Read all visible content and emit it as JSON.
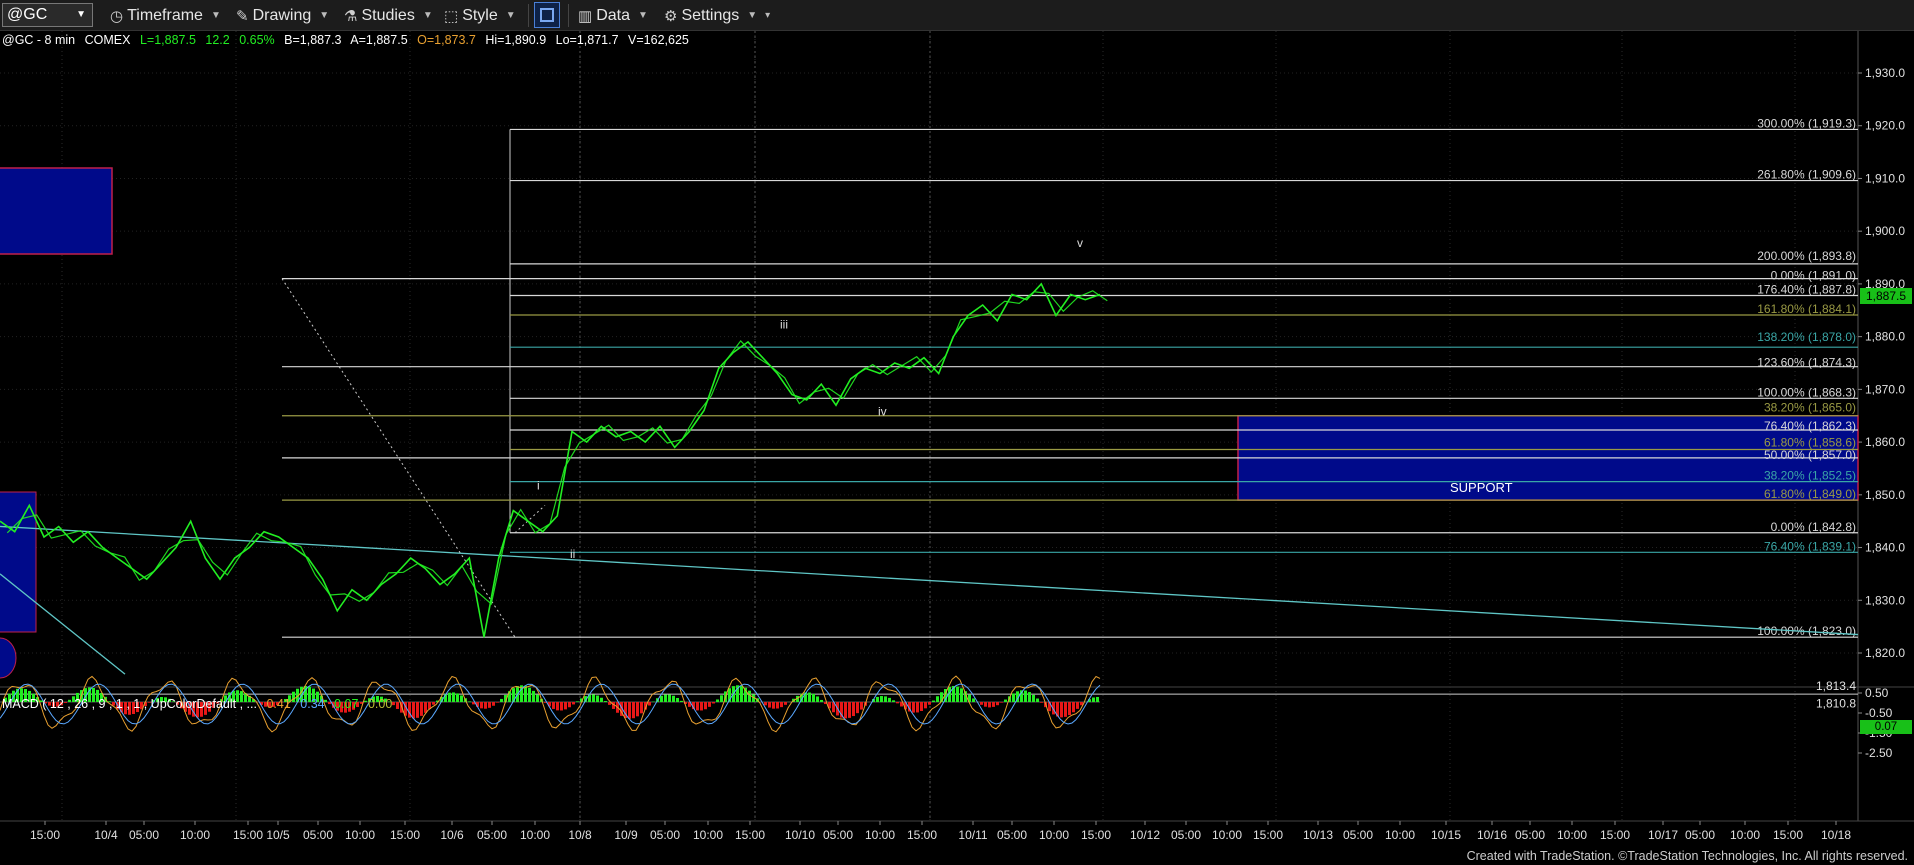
{
  "toolbar": {
    "symbol": "@GC",
    "timeframe": "Timeframe",
    "drawing": "Drawing",
    "studies": "Studies",
    "style": "Style",
    "data": "Data",
    "settings": "Settings"
  },
  "legend": {
    "symbol": "@GC - 8 min",
    "exchange": "COMEX",
    "last": "L=1,887.5",
    "change": "12.2",
    "pct": "0.65%",
    "bid": "B=1,887.3",
    "ask": "A=1,887.5",
    "open": "O=1,873.7",
    "high": "Hi=1,890.9",
    "low": "Lo=1,871.7",
    "volume": "V=162,625"
  },
  "macd_legend": {
    "label": "MACD ( 12 , 26 , 9 , 1 , 1 , UpColorDefault , ...",
    "v1": "0.41",
    "v2": "0.34",
    "v3": "0.07",
    "v4": "0.00"
  },
  "price_tag": "1,887.5",
  "macd_tag": "0.07",
  "footer": "Created with TradeStation. ©TradeStation Technologies, Inc. All rights reserved.",
  "colors": {
    "price": "#22ee22",
    "fib_white": "#d8d8d8",
    "fib_olive": "#9a9a44",
    "fib_teal": "#3aa6a6",
    "support_box": "#000a8a",
    "support_border": "#c0204a",
    "trendline": "#5fc6c6",
    "hist_pos": "#22ee22",
    "hist_neg": "#e81818"
  },
  "chart_data": {
    "type": "line",
    "title": "",
    "price_axis": {
      "min": 1810,
      "max": 1935,
      "ticks": [
        1820,
        1830,
        1840,
        1850,
        1860,
        1870,
        1880,
        1890,
        1900,
        1910,
        1920,
        1930
      ],
      "tick_labels": [
        "1,820.0",
        "1,830.0",
        "1,840.0",
        "1,850.0",
        "1,860.0",
        "1,870.0",
        "1,880.0",
        "1,890.0",
        "1,900.0",
        "1,910.0",
        "1,920.0",
        "1,930.0"
      ]
    },
    "macd_axis": {
      "ticks": [
        0.5,
        -0.5,
        -1.5,
        -2.5
      ],
      "tick_labels": [
        "0.50",
        "-0.50",
        "-1.50",
        "-2.50"
      ]
    },
    "time_labels": [
      "15:00",
      "10/4",
      "05:00",
      "10:00",
      "15:00",
      "10/5",
      "05:00",
      "10:00",
      "15:00",
      "10/6",
      "05:00",
      "10:00",
      "10/8",
      "10/9",
      "05:00",
      "10:00",
      "15:00",
      "10/10",
      "05:00",
      "10:00",
      "15:00",
      "10/11",
      "05:00",
      "10:00",
      "15:00",
      "10/12",
      "05:00",
      "10:00",
      "15:00",
      "10/13",
      "05:00",
      "10:00",
      "10/15",
      "10/16",
      "05:00",
      "10:00",
      "15:00",
      "10/17",
      "05:00",
      "10:00",
      "15:00",
      "10/18"
    ],
    "series": [
      {
        "values": [
          [
            0,
            1845
          ],
          [
            1,
            1843
          ],
          [
            2,
            1848
          ],
          [
            3,
            1842
          ],
          [
            4,
            1844
          ],
          [
            5,
            1841
          ],
          [
            6,
            1843
          ],
          [
            7,
            1840
          ],
          [
            8,
            1838
          ],
          [
            9,
            1836
          ],
          [
            10,
            1834
          ],
          [
            11,
            1837
          ],
          [
            12,
            1840
          ],
          [
            13,
            1845
          ],
          [
            14,
            1838
          ],
          [
            15,
            1834
          ],
          [
            16,
            1838
          ],
          [
            17,
            1840
          ],
          [
            18,
            1843
          ],
          [
            19,
            1842
          ],
          [
            20,
            1840
          ],
          [
            21,
            1838
          ],
          [
            22,
            1834
          ],
          [
            23,
            1828
          ],
          [
            24,
            1832
          ],
          [
            25,
            1830
          ],
          [
            26,
            1833
          ],
          [
            27,
            1835
          ],
          [
            28,
            1838
          ],
          [
            29,
            1836
          ],
          [
            30,
            1833
          ],
          [
            31,
            1835
          ],
          [
            32,
            1838
          ],
          [
            33,
            1823
          ],
          [
            34,
            1838
          ],
          [
            35,
            1847
          ],
          [
            36,
            1845
          ],
          [
            37,
            1843
          ],
          [
            38,
            1846
          ],
          [
            39,
            1862
          ],
          [
            40,
            1860
          ],
          [
            41,
            1863
          ],
          [
            42,
            1861
          ],
          [
            43,
            1862
          ],
          [
            44,
            1860
          ],
          [
            45,
            1863
          ],
          [
            46,
            1859
          ],
          [
            47,
            1862
          ],
          [
            48,
            1866
          ],
          [
            49,
            1874
          ],
          [
            50,
            1877
          ],
          [
            51,
            1879
          ],
          [
            52,
            1876
          ],
          [
            53,
            1873
          ],
          [
            54,
            1869
          ],
          [
            55,
            1868
          ],
          [
            56,
            1871
          ],
          [
            57,
            1867
          ],
          [
            58,
            1872
          ],
          [
            59,
            1874
          ],
          [
            60,
            1873
          ],
          [
            61,
            1875
          ],
          [
            62,
            1874
          ],
          [
            63,
            1876
          ],
          [
            64,
            1873
          ],
          [
            65,
            1880
          ],
          [
            66,
            1884
          ],
          [
            67,
            1886
          ],
          [
            68,
            1883
          ],
          [
            69,
            1888
          ],
          [
            70,
            1887
          ],
          [
            71,
            1890
          ],
          [
            72,
            1884
          ],
          [
            73,
            1888
          ],
          [
            74,
            1887
          ],
          [
            75,
            1888
          ]
        ]
      }
    ],
    "fib_lines": [
      {
        "label": "300.00% (1,919.3)",
        "price": 1919.3,
        "color": "fib_white"
      },
      {
        "label": "261.80% (1,909.6)",
        "price": 1909.6,
        "color": "fib_white"
      },
      {
        "label": "200.00% (1,893.8)",
        "price": 1893.8,
        "color": "fib_white"
      },
      {
        "label": "0.00% (1,891.0)",
        "price": 1891.0,
        "color": "fib_white"
      },
      {
        "label": "176.40% (1,887.8)",
        "price": 1887.8,
        "color": "fib_white"
      },
      {
        "label": "161.80% (1,884.1)",
        "price": 1884.1,
        "color": "fib_olive"
      },
      {
        "label": "138.20% (1,878.0)",
        "price": 1878.0,
        "color": "fib_teal"
      },
      {
        "label": "123.60% (1,874.3)",
        "price": 1874.3,
        "color": "fib_white"
      },
      {
        "label": "100.00% (1,868.3)",
        "price": 1868.3,
        "color": "fib_white"
      },
      {
        "label": "38.20% (1,865.0)",
        "price": 1865.0,
        "color": "fib_olive"
      },
      {
        "label": "76.40% (1,862.3)",
        "price": 1862.3,
        "color": "fib_white"
      },
      {
        "label": "61.80% (1,858.6)",
        "price": 1858.6,
        "color": "fib_olive"
      },
      {
        "label": "50.00% (1,857.0)",
        "price": 1857.0,
        "color": "fib_white"
      },
      {
        "label": "38.20% (1,852.5)",
        "price": 1852.5,
        "color": "fib_teal"
      },
      {
        "label": "61.80% (1,849.0)",
        "price": 1849.0,
        "color": "fib_olive"
      },
      {
        "label": "0.00% (1,842.8)",
        "price": 1842.8,
        "color": "fib_white"
      },
      {
        "label": "76.40% (1,839.1)",
        "price": 1839.1,
        "color": "fib_teal"
      },
      {
        "label": "100.00% (1,823.0)",
        "price": 1823.0,
        "color": "fib_white"
      }
    ],
    "extra_labels": [
      "1,813.4",
      "1,810.8"
    ],
    "support_zone": {
      "label": "SUPPORT",
      "top": 1865.0,
      "bottom": 1849.0
    },
    "wave_labels": [
      {
        "text": "i",
        "price": 1851
      },
      {
        "text": "ii",
        "price": 1838
      },
      {
        "text": "iii",
        "price": 1881.5
      },
      {
        "text": "iv",
        "price": 1865
      },
      {
        "text": "v",
        "price": 1897
      }
    ],
    "grid": true
  }
}
